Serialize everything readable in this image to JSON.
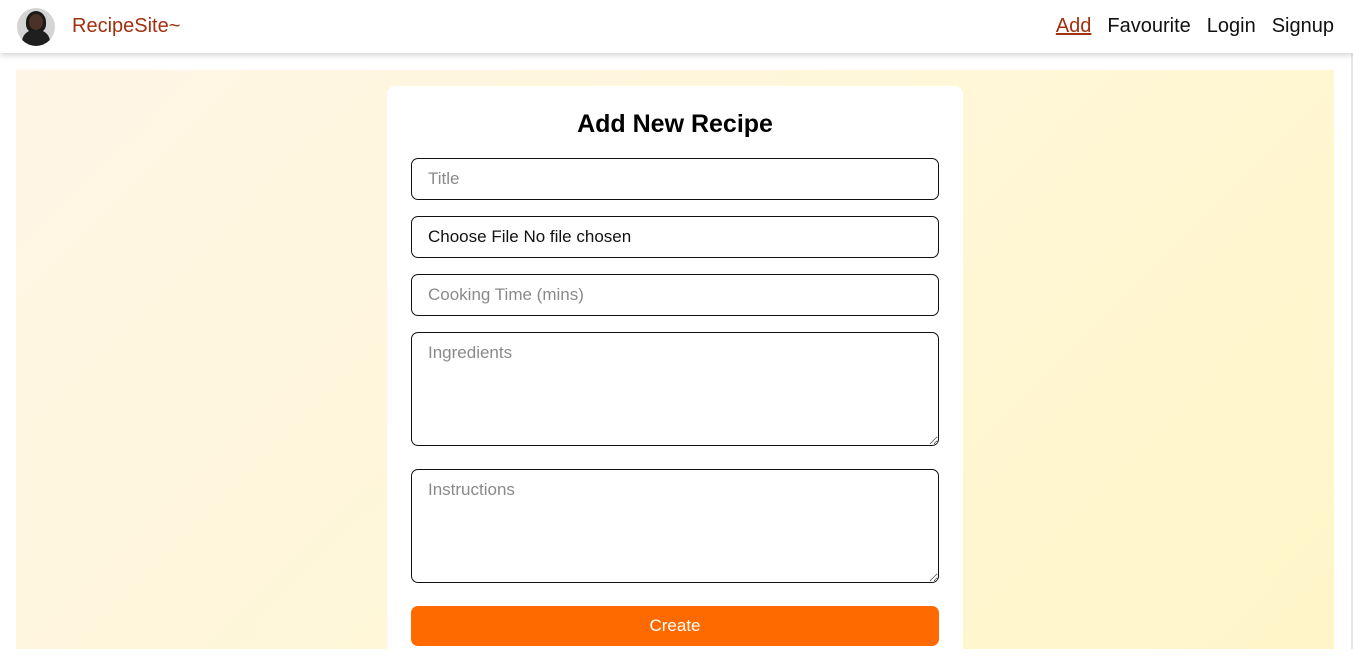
{
  "navbar": {
    "brand_name": "RecipeSite~",
    "avatar_icon": "user-avatar",
    "links": [
      {
        "label": "Add",
        "active": true
      },
      {
        "label": "Favourite",
        "active": false
      },
      {
        "label": "Login",
        "active": false
      },
      {
        "label": "Signup",
        "active": false
      }
    ]
  },
  "form": {
    "heading": "Add New Recipe",
    "title_placeholder": "Title",
    "file_button_label": "Choose File",
    "file_status": "No file chosen",
    "cooking_time_placeholder": "Cooking Time (mins)",
    "ingredients_placeholder": "Ingredients",
    "instructions_placeholder": "Instructions",
    "submit_label": "Create"
  },
  "colors": {
    "brand": "#a0300e",
    "accent_button": "#ff6a00",
    "background_gradient_start": "#fff5e6",
    "background_gradient_end": "#fff5c8"
  }
}
